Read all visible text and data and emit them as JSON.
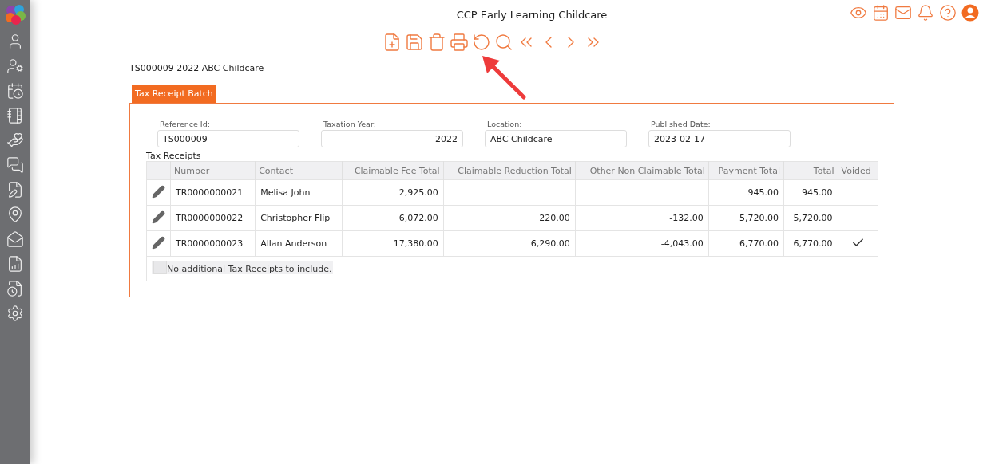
{
  "header": {
    "title": "CCP Early Learning Childcare"
  },
  "record_title": "TS000009 2022 ABC Childcare",
  "tabs": [
    {
      "label": "Tax Receipt Batch",
      "selected": true
    }
  ],
  "fields": [
    {
      "label": "Reference Id:",
      "value": "TS000009",
      "kind": "text"
    },
    {
      "label": "Taxation Year:",
      "value": "2022",
      "kind": "number"
    },
    {
      "label": "Location:",
      "value": "ABC Childcare",
      "kind": "text"
    },
    {
      "label": "Published Date:",
      "value": "2023-02-17",
      "kind": "text"
    }
  ],
  "table": {
    "title": "Tax Receipts",
    "columns": [
      {
        "label": "Number",
        "kind": "text"
      },
      {
        "label": "Contact",
        "kind": "text"
      },
      {
        "label": "Claimable Fee Total",
        "kind": "amount"
      },
      {
        "label": "Claimable Reduction Total",
        "kind": "amount"
      },
      {
        "label": "Other Non Claimable Total",
        "kind": "amount"
      },
      {
        "label": "Payment Total",
        "kind": "amount"
      },
      {
        "label": "Total",
        "kind": "amount"
      },
      {
        "label": "Voided",
        "kind": "flag"
      }
    ],
    "rows": [
      {
        "cells": [
          "TR0000000021",
          "Melisa John",
          "2,925.00",
          "",
          "",
          "945.00",
          "945.00"
        ],
        "voided": false
      },
      {
        "cells": [
          "TR0000000022",
          "Christopher Flip",
          "6,072.00",
          "220.00",
          "-132.00",
          "5,720.00",
          "5,720.00"
        ],
        "voided": false
      },
      {
        "cells": [
          "TR0000000023",
          "Allan Anderson",
          "17,380.00",
          "6,290.00",
          "-4,043.00",
          "6,770.00",
          "6,770.00"
        ],
        "voided": true
      }
    ]
  },
  "footer_option": {
    "label": "No additional Tax Receipts to include.",
    "checked": false
  }
}
